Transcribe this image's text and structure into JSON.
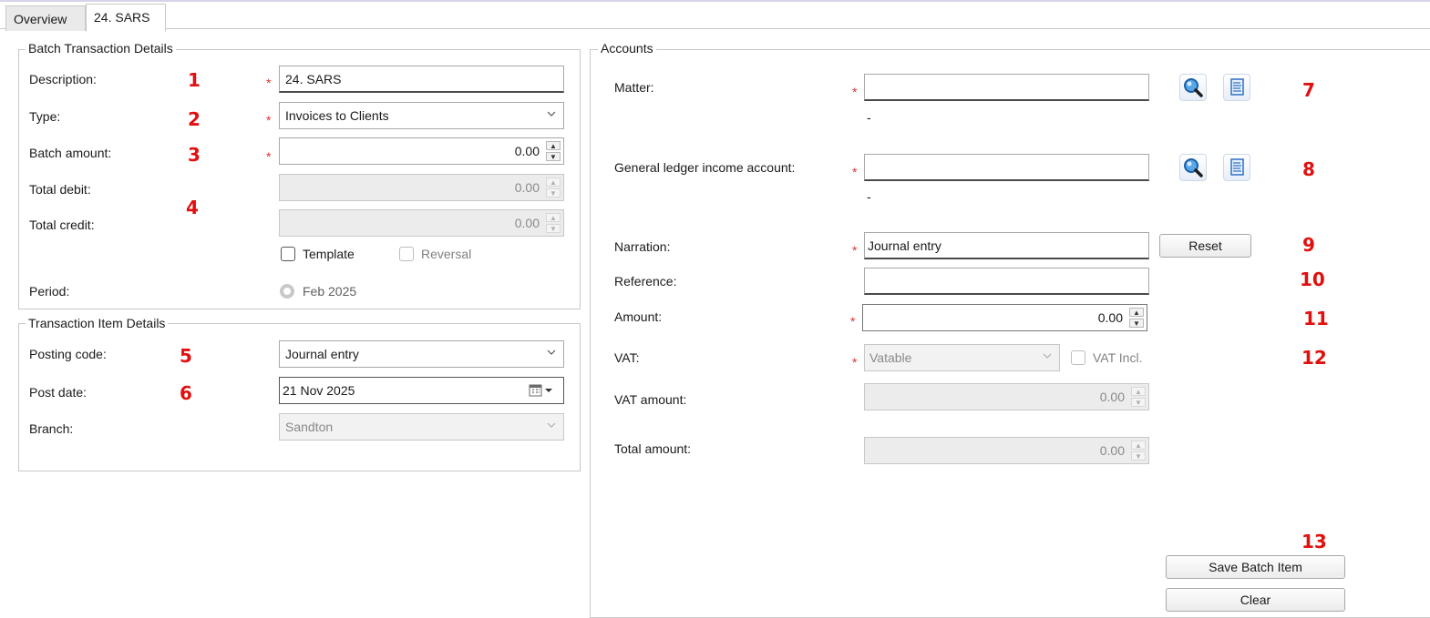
{
  "tabs": [
    {
      "label": "Overview"
    },
    {
      "label": "24. SARS"
    }
  ],
  "batch": {
    "legend": "Batch Transaction Details",
    "description_label": "Description:",
    "description_value": "24. SARS",
    "type_label": "Type:",
    "type_value": "Invoices to Clients",
    "batch_amount_label": "Batch amount:",
    "batch_amount_value": "0.00",
    "total_debit_label": "Total debit:",
    "total_debit_value": "0.00",
    "total_credit_label": "Total credit:",
    "total_credit_value": "0.00",
    "template_label": "Template",
    "reversal_label": "Reversal",
    "period_label": "Period:",
    "period_value": "Feb 2025"
  },
  "item": {
    "legend": "Transaction Item Details",
    "posting_code_label": "Posting code:",
    "posting_code_value": "Journal entry",
    "post_date_label": "Post date:",
    "post_date_value": "21 Nov  2025",
    "branch_label": "Branch:",
    "branch_value": "Sandton"
  },
  "accounts": {
    "legend": "Accounts",
    "matter_label": "Matter:",
    "matter_value": "",
    "matter_sub": "-",
    "gl_label": "General ledger income account:",
    "gl_value": "",
    "gl_sub": "-",
    "narration_label": "Narration:",
    "narration_value": "Journal entry",
    "reset_label": "Reset",
    "reference_label": "Reference:",
    "reference_value": "",
    "amount_label": "Amount:",
    "amount_value": "0.00",
    "vat_label": "VAT:",
    "vat_value": "Vatable",
    "vat_incl_label": "VAT Incl.",
    "vat_amount_label": "VAT amount:",
    "vat_amount_value": "0.00",
    "total_amount_label": "Total amount:",
    "total_amount_value": "0.00",
    "save_label": "Save Batch Item",
    "clear_label": "Clear"
  },
  "annotations": [
    "1",
    "2",
    "3",
    "4",
    "5",
    "6",
    "7",
    "8",
    "9",
    "10",
    "11",
    "12",
    "13"
  ],
  "required_marker": "*",
  "colors": {
    "required": "#e03030",
    "annotation": "#e01010",
    "disabled_bg": "#ececec",
    "border": "#c8c8c8"
  },
  "icons": {
    "search": "search-icon",
    "document": "document-icon",
    "calendar": "calendar-icon",
    "dropdown": "chevron-down-icon"
  }
}
